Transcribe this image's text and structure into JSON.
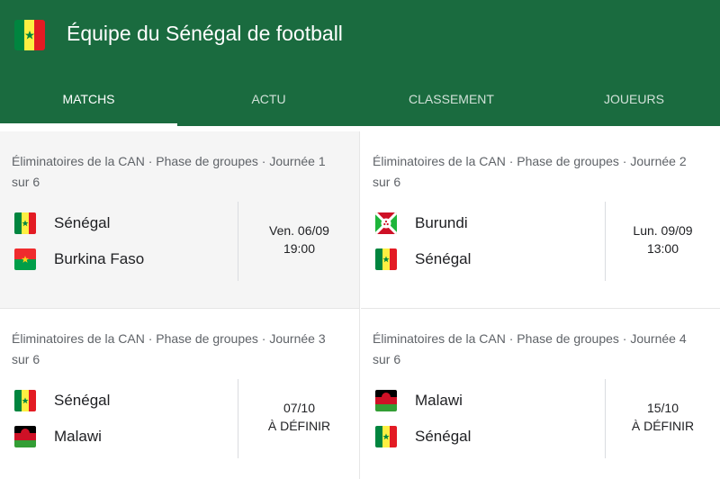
{
  "header": {
    "title": "Équipe du Sénégal de football",
    "flag": "senegal-flag",
    "background": "#1a6b3f"
  },
  "tabs": [
    {
      "label": "MATCHS",
      "active": true
    },
    {
      "label": "ACTU",
      "active": false
    },
    {
      "label": "CLASSEMENT",
      "active": false
    },
    {
      "label": "JOUEURS",
      "active": false
    }
  ],
  "matches": [
    {
      "competition": "Éliminatoires de la CAN · Phase de groupes · Journée 1 sur 6",
      "home": {
        "name": "Sénégal",
        "flag": "senegal-flag"
      },
      "away": {
        "name": "Burkina Faso",
        "flag": "burkina-faso-flag"
      },
      "date": "Ven. 06/09",
      "time": "19:00"
    },
    {
      "competition": "Éliminatoires de la CAN · Phase de groupes · Journée 2 sur 6",
      "home": {
        "name": "Burundi",
        "flag": "burundi-flag"
      },
      "away": {
        "name": "Sénégal",
        "flag": "senegal-flag"
      },
      "date": "Lun. 09/09",
      "time": "13:00"
    },
    {
      "competition": "Éliminatoires de la CAN · Phase de groupes · Journée 3 sur 6",
      "home": {
        "name": "Sénégal",
        "flag": "senegal-flag"
      },
      "away": {
        "name": "Malawi",
        "flag": "malawi-flag"
      },
      "date": "07/10",
      "time": "À DÉFINIR"
    },
    {
      "competition": "Éliminatoires de la CAN · Phase de groupes · Journée 4 sur 6",
      "home": {
        "name": "Malawi",
        "flag": "malawi-flag"
      },
      "away": {
        "name": "Sénégal",
        "flag": "senegal-flag"
      },
      "date": "15/10",
      "time": "À DÉFINIR"
    }
  ]
}
